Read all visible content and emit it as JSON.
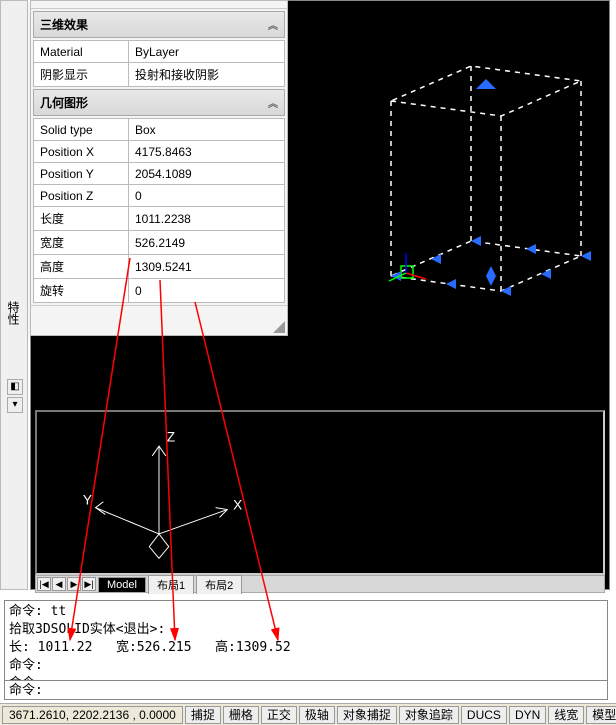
{
  "panel": {
    "section3d": {
      "title": "三维效果",
      "rows": [
        {
          "label": "Material",
          "value": "ByLayer"
        },
        {
          "label": "阴影显示",
          "value": "投射和接收阴影"
        }
      ]
    },
    "sectionGeom": {
      "title": "几何图形",
      "rows": [
        {
          "label": "Solid type",
          "value": "Box"
        },
        {
          "label": "Position X",
          "value": "4175.8463"
        },
        {
          "label": "Position Y",
          "value": "2054.1089"
        },
        {
          "label": "Position Z",
          "value": "0"
        },
        {
          "label": "长度",
          "value": "1011.2238"
        },
        {
          "label": "宽度",
          "value": "526.2149"
        },
        {
          "label": "高度",
          "value": "1309.5241"
        },
        {
          "label": "旋转",
          "value": "0"
        }
      ]
    }
  },
  "sidebar": {
    "vlabel": "特性"
  },
  "axes": {
    "x": "X",
    "y": "Y",
    "z": "Z"
  },
  "tabs": {
    "nav": [
      "|◀",
      "◀",
      "▶",
      "▶|"
    ],
    "items": [
      "Model",
      "布局1",
      "布局2"
    ]
  },
  "cmd": {
    "line1": "命令: tt",
    "line2": "拾取3DSOLID实体<退出>:",
    "line3_a": "长: 1011.22",
    "line3_b": "宽:526.215",
    "line3_c": "高:1309.52",
    "line4": "命令:",
    "line5": "命令:",
    "input_prefix": "命令:"
  },
  "status": {
    "coords": "3671.2610, 2202.2136 , 0.0000",
    "buttons": [
      "捕捉",
      "栅格",
      "正交",
      "极轴",
      "对象捕捉",
      "对象追踪",
      "DUCS",
      "DYN",
      "线宽",
      "模型"
    ]
  }
}
